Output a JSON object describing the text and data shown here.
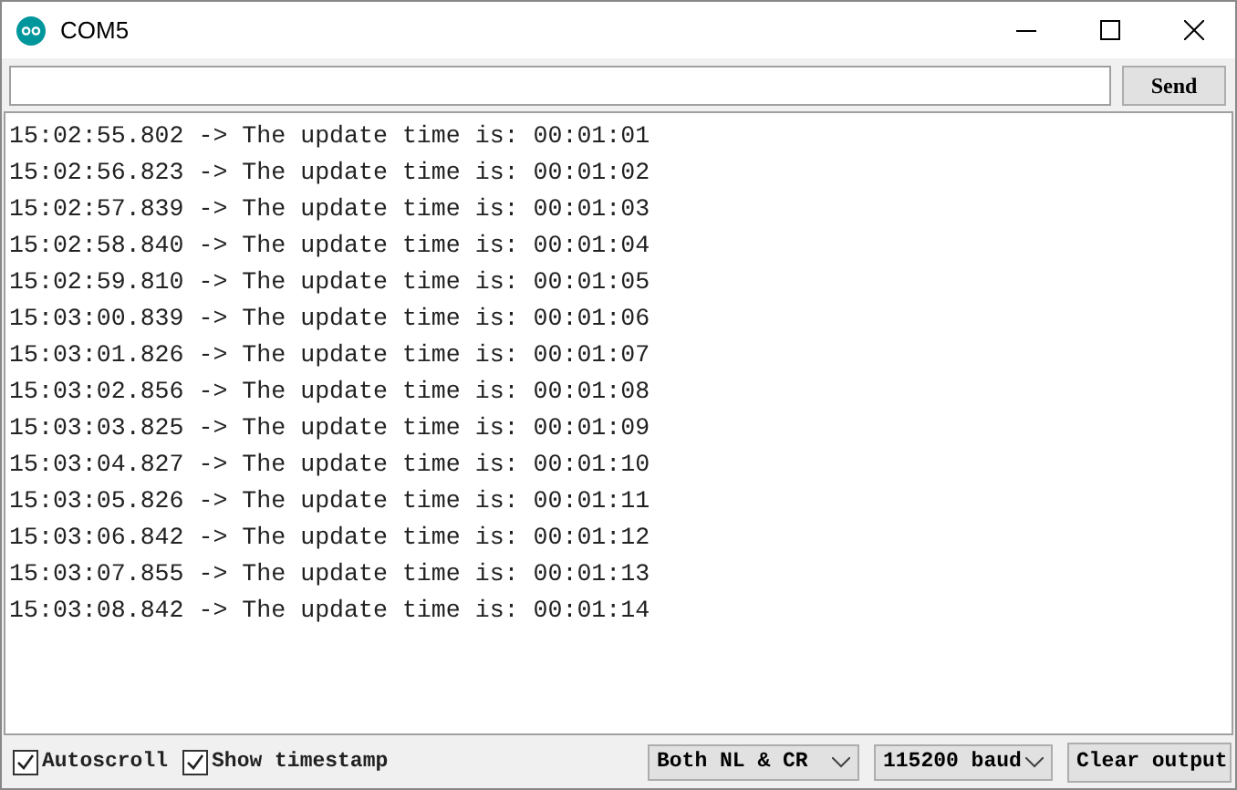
{
  "window": {
    "title": "COM5"
  },
  "input": {
    "send_label": "Send"
  },
  "output": {
    "lines": [
      "15:02:55.802 -> The update time is: 00:01:01",
      "15:02:56.823 -> The update time is: 00:01:02",
      "15:02:57.839 -> The update time is: 00:01:03",
      "15:02:58.840 -> The update time is: 00:01:04",
      "15:02:59.810 -> The update time is: 00:01:05",
      "15:03:00.839 -> The update time is: 00:01:06",
      "15:03:01.826 -> The update time is: 00:01:07",
      "15:03:02.856 -> The update time is: 00:01:08",
      "15:03:03.825 -> The update time is: 00:01:09",
      "15:03:04.827 -> The update time is: 00:01:10",
      "15:03:05.826 -> The update time is: 00:01:11",
      "15:03:06.842 -> The update time is: 00:01:12",
      "15:03:07.855 -> The update time is: 00:01:13",
      "15:03:08.842 -> The update time is: 00:01:14"
    ]
  },
  "status_bar": {
    "checkboxes": [
      {
        "label": "Autoscroll",
        "checked": true
      },
      {
        "label": "Show timestamp",
        "checked": true
      }
    ],
    "line_ending": "Both NL & CR",
    "baud": "115200 baud",
    "clear_label": "Clear output"
  }
}
